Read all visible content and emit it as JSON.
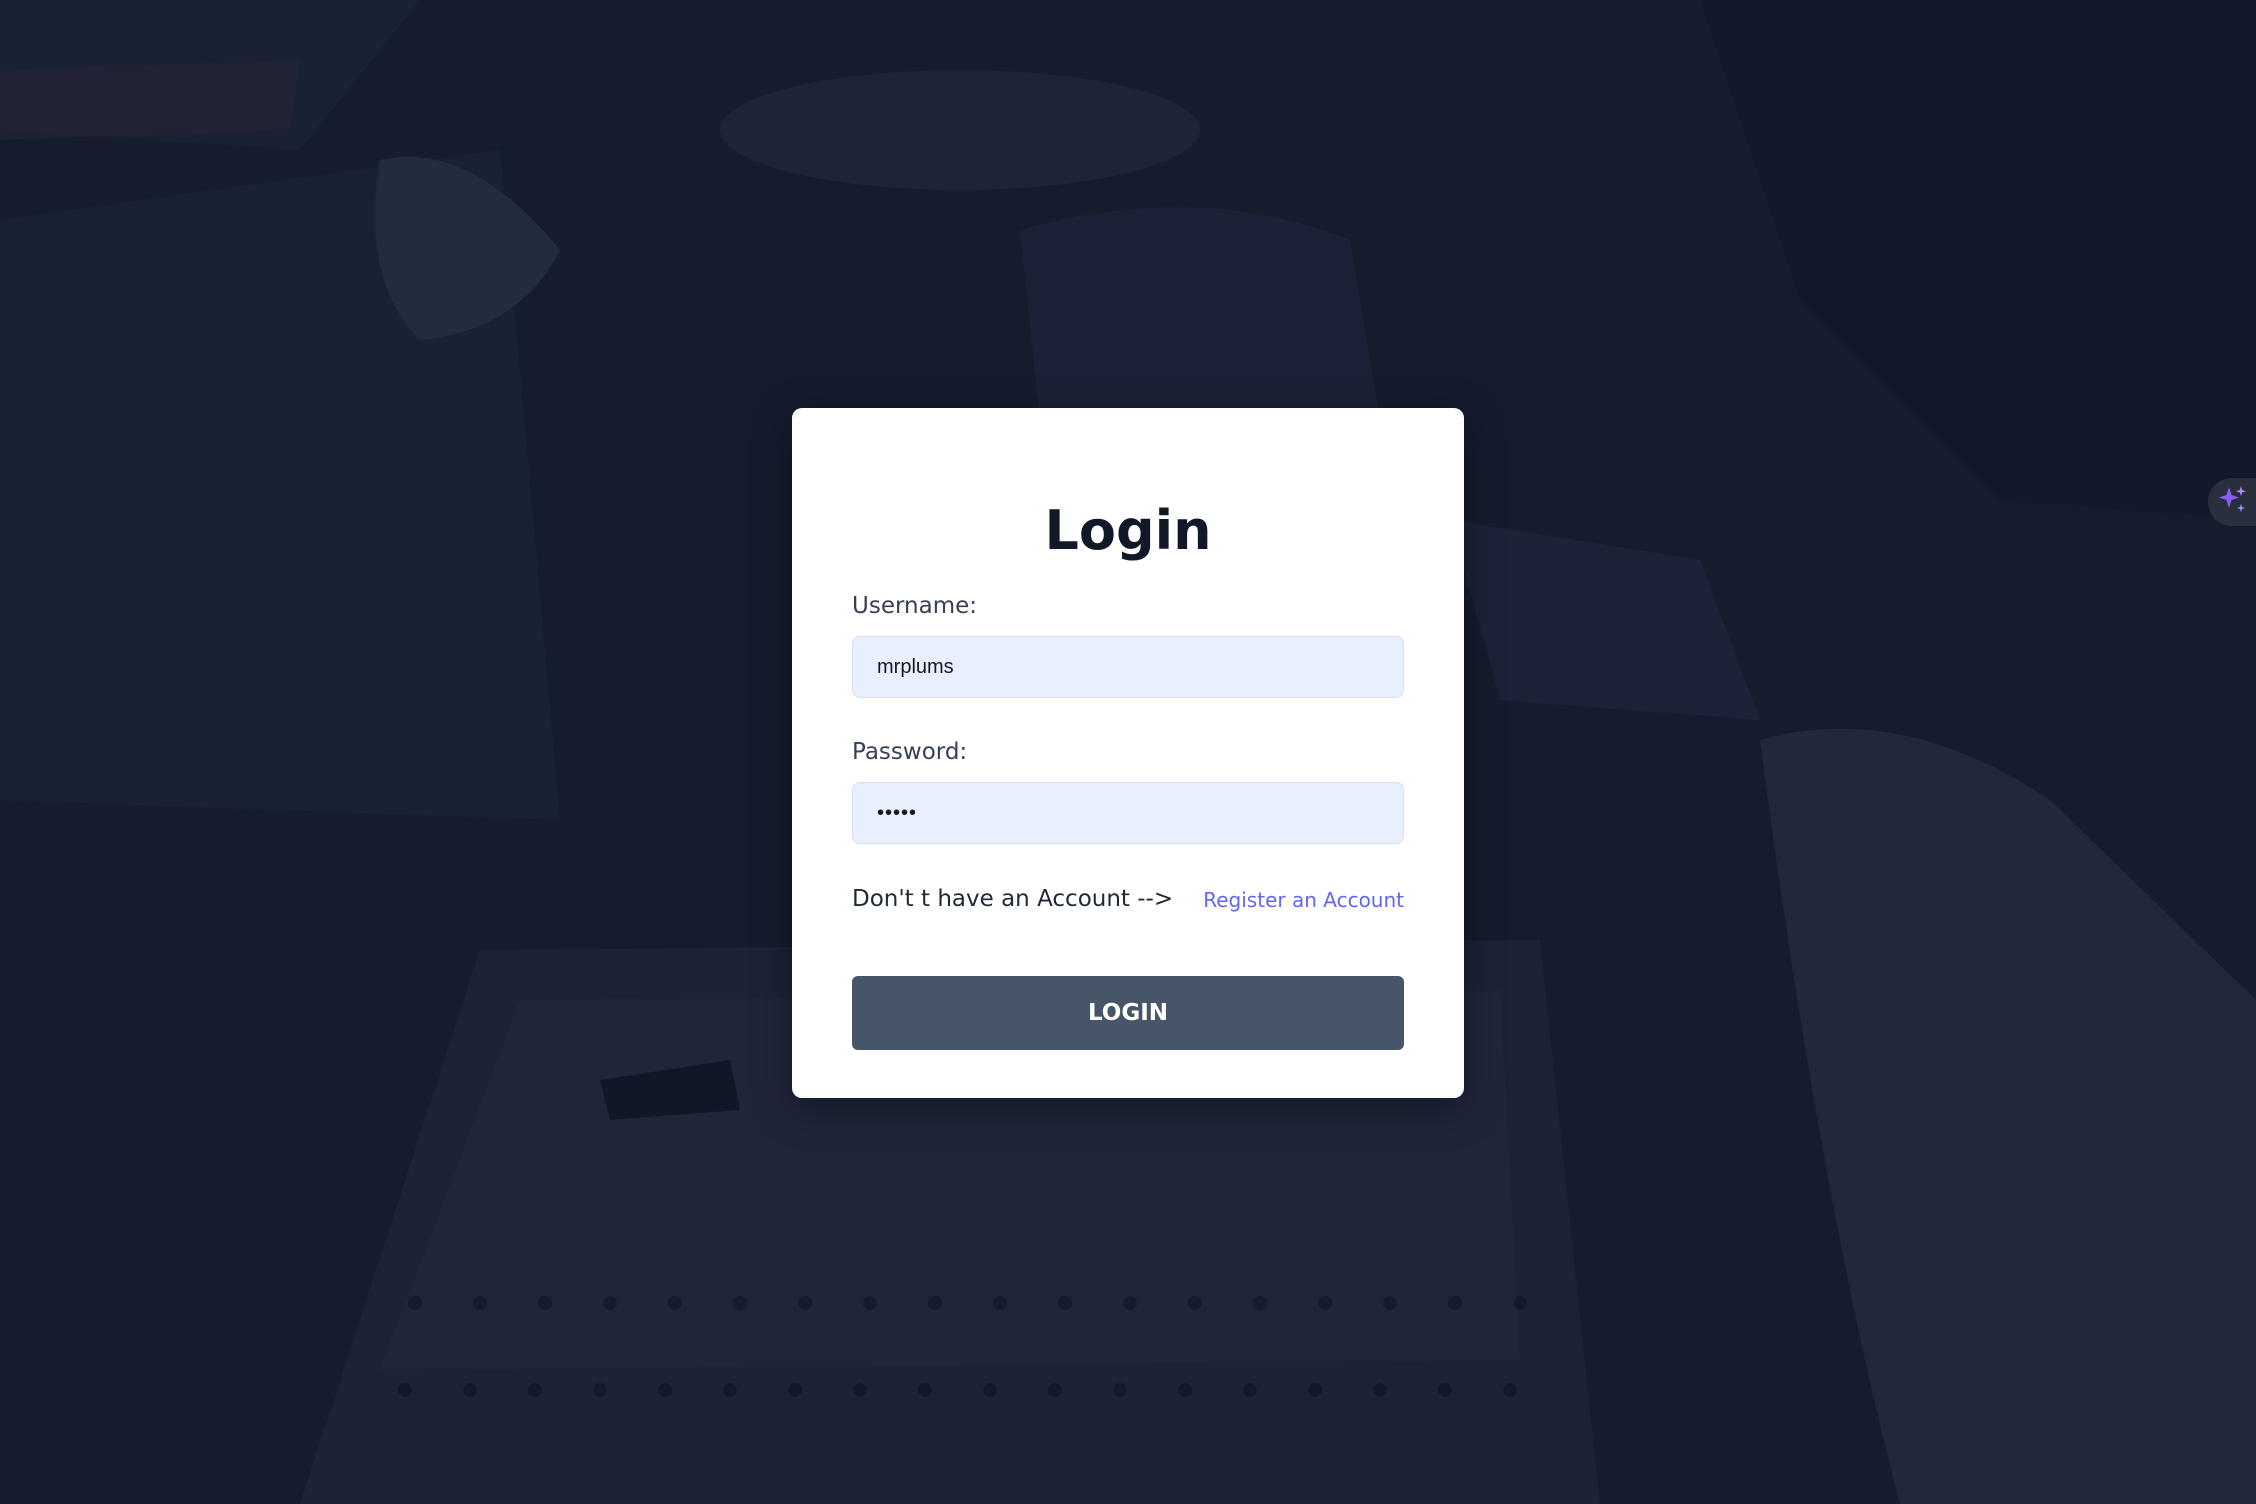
{
  "login_form": {
    "title": "Login",
    "username_label": "Username:",
    "username_value": "mrplums",
    "password_label": "Password:",
    "password_value": "•••••",
    "register_prompt": "Don't t have an Account -->",
    "register_link": "Register an Account",
    "login_button": "LOGIN"
  },
  "icons": {
    "extension": "sparkle-icon"
  },
  "colors": {
    "background": "#1c2235",
    "card": "#ffffff",
    "input_fill": "#e8f0fe",
    "link": "#6366f1",
    "button": "#475569",
    "sparkle": "#8b5cf6"
  }
}
